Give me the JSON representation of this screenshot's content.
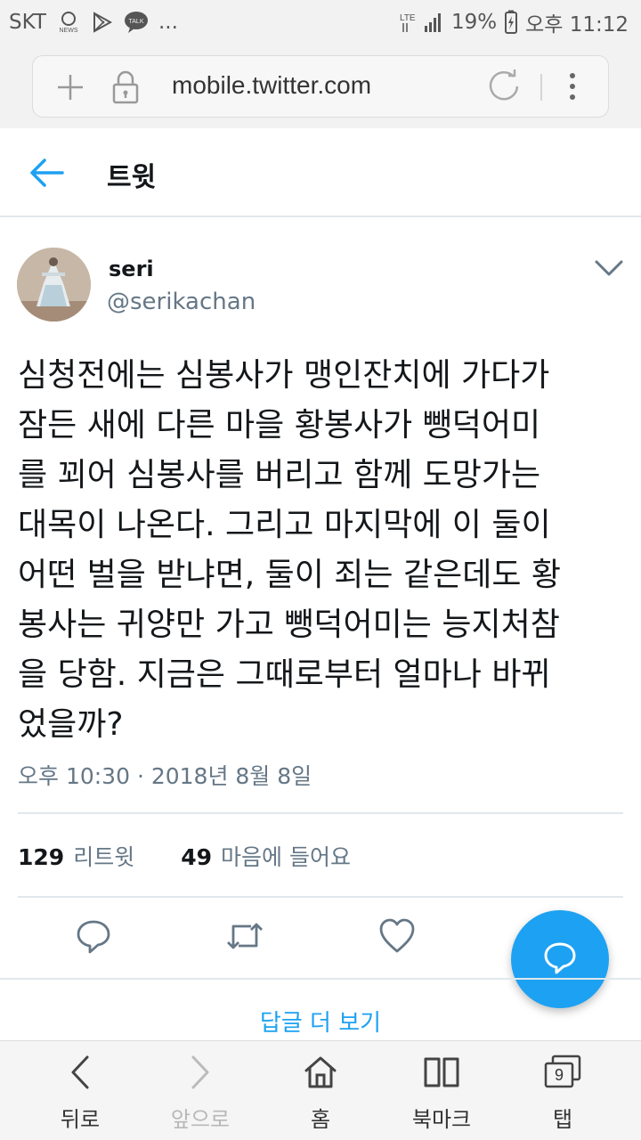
{
  "status_bar": {
    "carrier": "SKT",
    "more": "...",
    "network": "LTE",
    "battery": "19%",
    "time": "오후 11:12"
  },
  "browser": {
    "url": "mobile.twitter.com"
  },
  "header": {
    "title": "트윗"
  },
  "tweet": {
    "author_name": "seri",
    "author_handle": "@serikachan",
    "text_lines": [
      "심청전에는 심봉사가 맹인잔치에 가다가",
      "잠든 새에 다른 마을 황봉사가 뺑덕어미",
      "를 꾀어 심봉사를 버리고 함께 도망가는",
      "대목이 나온다. 그리고 마지막에 이 둘이",
      "어떤 벌을 받냐면, 둘이 죄는 같은데도 황",
      "봉사는 귀양만 가고 뺑덕어미는 능지처참",
      "을 당함. 지금은 그때로부터 얼마나 바뀌",
      "었을까?"
    ],
    "timestamp": "오후 10:30 · 2018년 8월 8일",
    "retweet_count": "129",
    "retweet_label": "리트윗",
    "like_count": "49",
    "like_label": "마음에 들어요"
  },
  "more_replies": "답글 더 보기",
  "bottom_nav": {
    "back": "뒤로",
    "forward": "앞으로",
    "home": "홈",
    "bookmarks": "북마크",
    "tabs": "탭",
    "tab_count": "9"
  },
  "colors": {
    "accent": "#1da1f2",
    "text": "#14171a",
    "muted": "#657786",
    "divider": "#e1e8ed"
  }
}
